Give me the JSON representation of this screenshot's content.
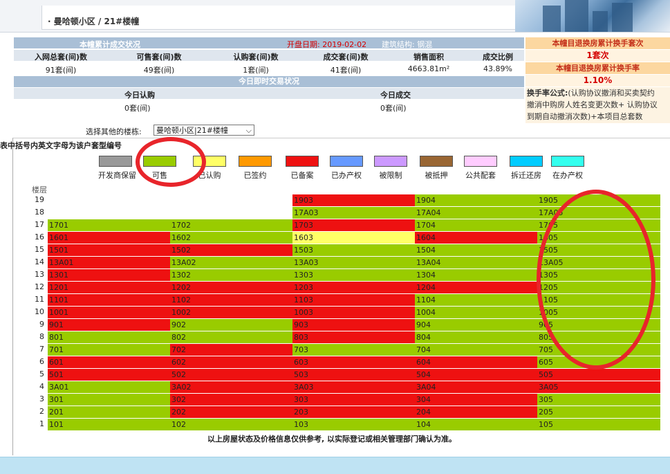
{
  "breadcrumb": "· 曼哈顿小区 / 21#楼幢",
  "summary": {
    "header": "本幢累计成交状况",
    "opening": "开盘日期: 2019-02-02",
    "structure": "建筑结构:  钢混",
    "col_heads": [
      "入网总套(间)数",
      "可售套(间)数",
      "认购套(间)数",
      "成交套(间)数",
      "销售面积",
      "成交比例"
    ],
    "values": [
      "91套(间)",
      "49套(间)",
      "1套(间)",
      "41套(间)",
      "4663.81m²",
      "43.89%"
    ]
  },
  "today": {
    "header": "今日即时交易状况",
    "sub_left": "今日认购",
    "sub_right": "今日成交",
    "val_left": "0套(间)",
    "val_right": "0套(间)"
  },
  "side": {
    "title1": "本幢目退换房累计换手套次",
    "val1": "1套次",
    "title2": "本幢目退换房累计换手率",
    "val2": "1.10%",
    "formula_label": "换手率公式:",
    "formula_line1": "(认购协议撤消和买卖契约",
    "formula_line2": "撤消中购房人姓名变更次数+ 认购协议",
    "formula_line3": "到期自动撤消次数)+本项目总套数"
  },
  "select": {
    "label": "选择其他的楼栋:",
    "value": "曼哈顿小区|21#楼幢"
  },
  "table_note": "表中括号内英文字母为该户套型编号",
  "legend": [
    {
      "label": "开发商保留",
      "color": "#999999"
    },
    {
      "label": "可售",
      "color": "#99cc00"
    },
    {
      "label": "已认购",
      "color": "#ffff66"
    },
    {
      "label": "已签约",
      "color": "#ff9900"
    },
    {
      "label": "已备案",
      "color": "#ee1111"
    },
    {
      "label": "已办产权",
      "color": "#6699ff"
    },
    {
      "label": "被限制",
      "color": "#cc99ff"
    },
    {
      "label": "被抵押",
      "color": "#996633"
    },
    {
      "label": "公共配套",
      "color": "#ffccff"
    },
    {
      "label": "拆迁还房",
      "color": "#00ccff"
    },
    {
      "label": "在办产权",
      "color": "#33ffee"
    }
  ],
  "floor_header": "楼层",
  "status_colors": {
    "g": "#99cc00",
    "r": "#ee1111",
    "y": "#ffff66"
  },
  "floors": [
    {
      "floor": "19",
      "units": [
        null,
        null,
        [
          "1903",
          "r"
        ],
        [
          "1904",
          "g"
        ],
        [
          "1905",
          "g"
        ]
      ]
    },
    {
      "floor": "18",
      "units": [
        null,
        null,
        [
          "17A03",
          "g"
        ],
        [
          "17A04",
          "g"
        ],
        [
          "17A05",
          "g"
        ]
      ]
    },
    {
      "floor": "17",
      "units": [
        [
          "1701",
          "g"
        ],
        [
          "1702",
          "g"
        ],
        [
          "1703",
          "r"
        ],
        [
          "1704",
          "g"
        ],
        [
          "1705",
          "g"
        ]
      ]
    },
    {
      "floor": "16",
      "units": [
        [
          "1601",
          "r"
        ],
        [
          "1602",
          "g"
        ],
        [
          "1603",
          "y"
        ],
        [
          "1604",
          "r"
        ],
        [
          "1605",
          "g"
        ]
      ]
    },
    {
      "floor": "15",
      "units": [
        [
          "1501",
          "r"
        ],
        [
          "1502",
          "r"
        ],
        [
          "1503",
          "g"
        ],
        [
          "1504",
          "g"
        ],
        [
          "1505",
          "g"
        ]
      ]
    },
    {
      "floor": "14",
      "units": [
        [
          "13A01",
          "r"
        ],
        [
          "13A02",
          "g"
        ],
        [
          "13A03",
          "g"
        ],
        [
          "13A04",
          "g"
        ],
        [
          "13A05",
          "g"
        ]
      ]
    },
    {
      "floor": "13",
      "units": [
        [
          "1301",
          "r"
        ],
        [
          "1302",
          "g"
        ],
        [
          "1303",
          "g"
        ],
        [
          "1304",
          "g"
        ],
        [
          "1305",
          "g"
        ]
      ]
    },
    {
      "floor": "12",
      "units": [
        [
          "1201",
          "r"
        ],
        [
          "1202",
          "r"
        ],
        [
          "1203",
          "r"
        ],
        [
          "1204",
          "r"
        ],
        [
          "1205",
          "g"
        ]
      ]
    },
    {
      "floor": "11",
      "units": [
        [
          "1101",
          "r"
        ],
        [
          "1102",
          "r"
        ],
        [
          "1103",
          "r"
        ],
        [
          "1104",
          "g"
        ],
        [
          "1105",
          "g"
        ]
      ]
    },
    {
      "floor": "10",
      "units": [
        [
          "1001",
          "r"
        ],
        [
          "1002",
          "r"
        ],
        [
          "1003",
          "r"
        ],
        [
          "1004",
          "g"
        ],
        [
          "1005",
          "g"
        ]
      ]
    },
    {
      "floor": "9",
      "units": [
        [
          "901",
          "r"
        ],
        [
          "902",
          "g"
        ],
        [
          "903",
          "r"
        ],
        [
          "904",
          "g"
        ],
        [
          "905",
          "g"
        ]
      ]
    },
    {
      "floor": "8",
      "units": [
        [
          "801",
          "g"
        ],
        [
          "802",
          "g"
        ],
        [
          "803",
          "r"
        ],
        [
          "804",
          "g"
        ],
        [
          "805",
          "g"
        ]
      ]
    },
    {
      "floor": "7",
      "units": [
        [
          "701",
          "g"
        ],
        [
          "702",
          "r"
        ],
        [
          "703",
          "g"
        ],
        [
          "704",
          "g"
        ],
        [
          "705",
          "g"
        ]
      ]
    },
    {
      "floor": "6",
      "units": [
        [
          "601",
          "r"
        ],
        [
          "602",
          "r"
        ],
        [
          "603",
          "r"
        ],
        [
          "604",
          "r"
        ],
        [
          "605",
          "g"
        ]
      ]
    },
    {
      "floor": "5",
      "units": [
        [
          "501",
          "r"
        ],
        [
          "502",
          "r"
        ],
        [
          "503",
          "r"
        ],
        [
          "504",
          "r"
        ],
        [
          "505",
          "r"
        ]
      ]
    },
    {
      "floor": "4",
      "units": [
        [
          "3A01",
          "g"
        ],
        [
          "3A02",
          "r"
        ],
        [
          "3A03",
          "r"
        ],
        [
          "3A04",
          "r"
        ],
        [
          "3A05",
          "r"
        ]
      ]
    },
    {
      "floor": "3",
      "units": [
        [
          "301",
          "g"
        ],
        [
          "302",
          "r"
        ],
        [
          "303",
          "r"
        ],
        [
          "304",
          "r"
        ],
        [
          "305",
          "g"
        ]
      ]
    },
    {
      "floor": "2",
      "units": [
        [
          "201",
          "g"
        ],
        [
          "202",
          "r"
        ],
        [
          "203",
          "r"
        ],
        [
          "204",
          "r"
        ],
        [
          "205",
          "g"
        ]
      ]
    },
    {
      "floor": "1",
      "units": [
        [
          "101",
          "g"
        ],
        [
          "102",
          "g"
        ],
        [
          "103",
          "g"
        ],
        [
          "104",
          "g"
        ],
        [
          "105",
          "g"
        ]
      ]
    }
  ],
  "footer_note": "以上房屋状态及价格信息仅供参考, 以实际登记或相关管理部门确认为准。"
}
